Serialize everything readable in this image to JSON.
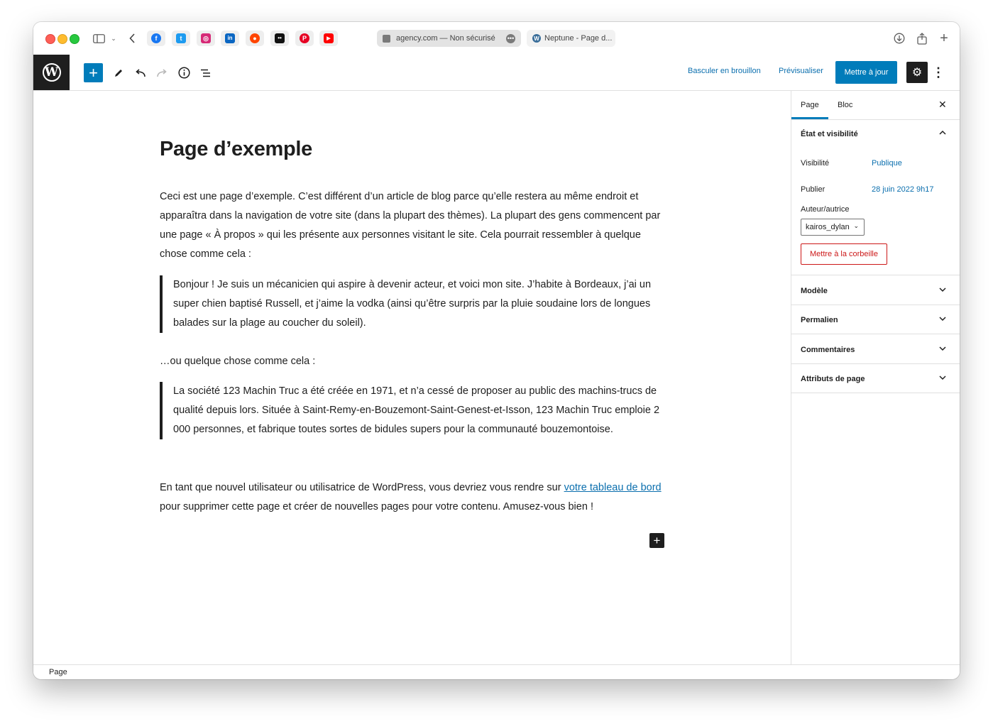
{
  "browser": {
    "active_tab": {
      "url": "agency.com — Non sécurisé"
    },
    "other_tab": {
      "title": "Neptune - Page d..."
    },
    "bookmarks": [
      {
        "name": "facebook-icon",
        "color": "#1877f2",
        "glyph": "f"
      },
      {
        "name": "twitter-icon",
        "color": "#1d9bf0",
        "glyph": "t"
      },
      {
        "name": "instagram-icon",
        "color": "#d62976",
        "glyph": "◎"
      },
      {
        "name": "linkedin-icon",
        "color": "#0a66c2",
        "glyph": "in"
      },
      {
        "name": "reddit-icon",
        "color": "#ff4500",
        "glyph": "●"
      },
      {
        "name": "flickr-icon",
        "color": "#111111",
        "glyph": "••"
      },
      {
        "name": "pinterest-icon",
        "color": "#e60023",
        "glyph": "P"
      },
      {
        "name": "youtube-icon",
        "color": "#ff0000",
        "glyph": "▶"
      }
    ]
  },
  "toolbar": {
    "switch_draft": "Basculer en brouillon",
    "preview": "Prévisualiser",
    "update": "Mettre à jour"
  },
  "post": {
    "title": "Page d’exemple",
    "intro": "Ceci est une page d’exemple. C’est différent d’un article de blog parce qu’elle restera au même endroit et apparaîtra dans la navigation de votre site (dans la plupart des thèmes). La plupart des gens commencent par une page « À propos » qui les présente aux personnes visitant le site. Cela pourrait ressembler à quelque chose comme cela :",
    "quote1": "Bonjour ! Je suis un mécanicien qui aspire à devenir acteur, et voici mon site. J’habite à Bordeaux, j’ai un super chien baptisé Russell, et j’aime la vodka (ainsi qu’être surpris par la pluie soudaine lors de longues balades sur la plage au coucher du soleil).",
    "middle": "…ou quelque chose comme cela :",
    "quote2": "La société 123 Machin Truc a été créée en 1971, et n’a cessé de proposer au public des machins-trucs de qualité depuis lors. Située à Saint-Remy-en-Bouzemont-Saint-Genest-et-Isson, 123 Machin Truc emploie 2 000 personnes, et fabrique toutes sortes de bidules supers pour la communauté bouzemontoise.",
    "outro_before": "En tant que nouvel utilisateur ou utilisatrice de WordPress, vous devriez vous rendre sur ",
    "outro_link": "votre tableau de bord",
    "outro_after": " pour supprimer cette page et créer de nouvelles pages pour votre contenu. Amusez-vous bien !"
  },
  "sidebar": {
    "tabs": [
      "Page",
      "Bloc"
    ],
    "status_panel": {
      "title": "État et visibilité",
      "visibility_label": "Visibilité",
      "visibility_value": "Publique",
      "publish_label": "Publier",
      "publish_value": "28 juin 2022 9h17",
      "author_label": "Auteur/autrice",
      "author_value": "kairos_dylan",
      "trash": "Mettre à la corbeille"
    },
    "panels": [
      "Modèle",
      "Permalien",
      "Commentaires",
      "Attributs de page"
    ]
  },
  "footer": {
    "breadcrumb": "Page"
  },
  "colors": {
    "accent": "#007cba",
    "link": "#0b6fae",
    "danger": "#cc1818",
    "dark": "#1e1e1e"
  }
}
